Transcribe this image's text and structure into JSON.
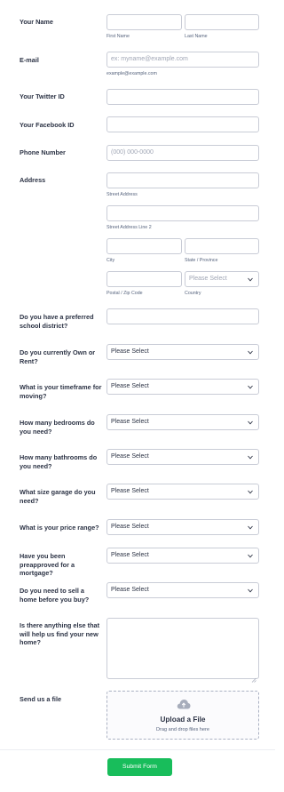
{
  "fields": {
    "name": {
      "label": "Your Name",
      "first_sub": "First Name",
      "last_sub": "Last Name"
    },
    "email": {
      "label": "E-mail",
      "placeholder": "ex: myname@example.com",
      "sub": "example@example.com"
    },
    "twitter": {
      "label": "Your Twitter ID"
    },
    "facebook": {
      "label": "Your Facebook ID"
    },
    "phone": {
      "label": "Phone Number",
      "placeholder": "(000) 000-0000"
    },
    "address": {
      "label": "Address",
      "street_sub": "Street Address",
      "street2_sub": "Street Address Line 2",
      "city_sub": "City",
      "state_sub": "State / Province",
      "zip_sub": "Postal / Zip Code",
      "country_sub": "Country",
      "country_value": "Please Select"
    },
    "school": {
      "label": "Do you have a preferred school district?"
    },
    "own_rent": {
      "label": "Do you currently Own or Rent?",
      "value": "Please Select"
    },
    "timeframe": {
      "label": "What is your timeframe for moving?",
      "value": "Please Select"
    },
    "bedrooms": {
      "label": "How many bedrooms do you need?",
      "value": "Please Select"
    },
    "bathrooms": {
      "label": "How many bathrooms do you need?",
      "value": "Please Select"
    },
    "garage": {
      "label": "What size garage do you need?",
      "value": "Please Select"
    },
    "price": {
      "label": "What is your price range?",
      "value": "Please Select"
    },
    "preapproved": {
      "label": "Have you been preapproved for a mortgage?",
      "value": "Please Select"
    },
    "sell_home": {
      "label": "Do you need to sell a home before you buy?",
      "value": "Please Select"
    },
    "anything_else": {
      "label": "Is there anything else that will help us find your new home?"
    },
    "file": {
      "label": "Send us a file",
      "upload_title": "Upload a File",
      "upload_hint": "Drag and drop files here"
    }
  },
  "submit_label": "Submit Form",
  "colors": {
    "accent": "#18bd5b",
    "border": "#c9ccd6",
    "label": "#2c3345"
  }
}
